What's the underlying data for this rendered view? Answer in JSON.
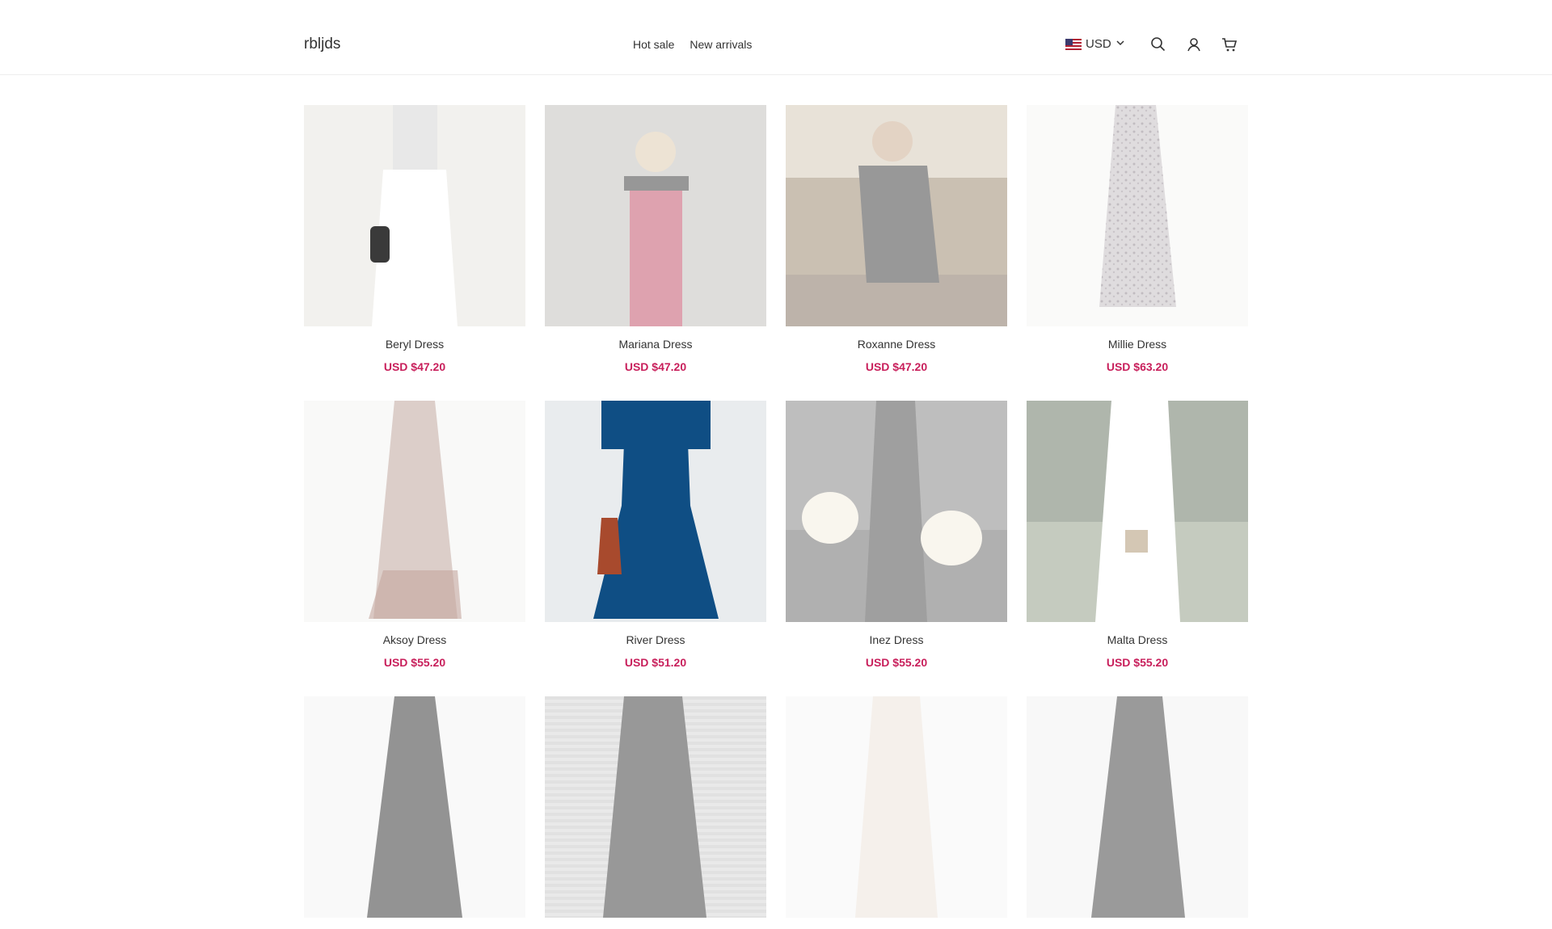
{
  "header": {
    "logo": "rbljds",
    "nav": [
      "Hot sale",
      "New arrivals"
    ],
    "currency": "USD",
    "icons": [
      "search-icon",
      "account-icon",
      "cart-icon"
    ]
  },
  "products": [
    {
      "title": "Beryl Dress",
      "price": "USD $47.20",
      "image": "white midi dress with striped top"
    },
    {
      "title": "Mariana Dress",
      "price": "USD $47.20",
      "image": "red strapless dress"
    },
    {
      "title": "Roxanne Dress",
      "price": "USD $47.20",
      "image": "black top seated"
    },
    {
      "title": "Millie Dress",
      "price": "USD $63.20",
      "image": "patterned maxi dress"
    },
    {
      "title": "Aksoy Dress",
      "price": "USD $55.20",
      "image": "floral midi dress"
    },
    {
      "title": "River Dress",
      "price": "USD $51.20",
      "image": "navy blue midi dress"
    },
    {
      "title": "Inez Dress",
      "price": "USD $55.20",
      "image": "sheer dark slip dress"
    },
    {
      "title": "Malta Dress",
      "price": "USD $55.20",
      "image": "white ruffle dress outdoor"
    },
    {
      "title": "",
      "price": "",
      "image": "dark dress"
    },
    {
      "title": "",
      "price": "",
      "image": "black dress"
    },
    {
      "title": "",
      "price": "",
      "image": "light dress"
    },
    {
      "title": "",
      "price": "",
      "image": "black tiered dress"
    }
  ]
}
